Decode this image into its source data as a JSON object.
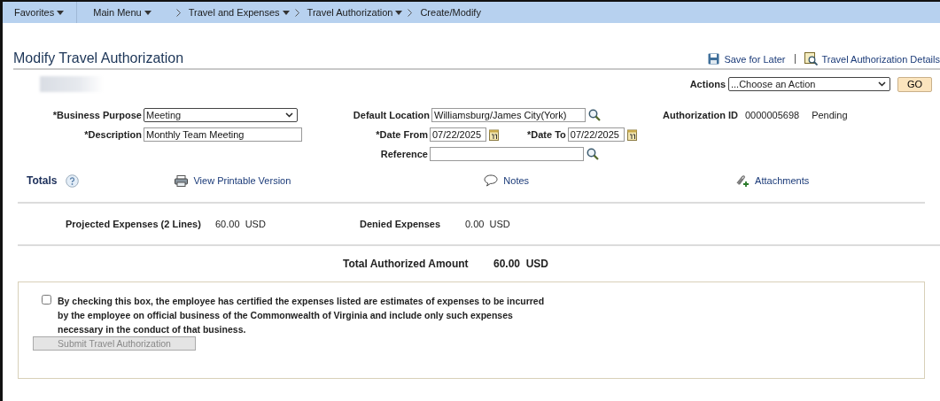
{
  "nav": {
    "favorites": {
      "label": "Favorites",
      "has_menu": true
    },
    "main_menu": {
      "label": "Main Menu",
      "has_menu": true
    },
    "breadcrumbs": [
      {
        "label": "Travel and Expenses",
        "has_menu": true
      },
      {
        "label": "Travel Authorization",
        "has_menu": true
      },
      {
        "label": "Create/Modify",
        "has_menu": false
      }
    ]
  },
  "page_title": "Modify Travel Authorization",
  "header_links": [
    {
      "label": "Save for Later",
      "kind": "save"
    },
    {
      "label": "Travel Authorization Details",
      "kind": "details"
    }
  ],
  "actions": {
    "label": "Actions",
    "value": "...Choose an Action",
    "button": "GO"
  },
  "form": {
    "business_purpose": {
      "label": "*Business Purpose",
      "value": "Meeting"
    },
    "description": {
      "label": "*Description",
      "value": "Monthly Team Meeting"
    },
    "default_location": {
      "label": "Default Location",
      "value": "Williamsburg/James City(York)"
    },
    "date_from": {
      "label": "*Date From",
      "value": "07/22/2025"
    },
    "date_to": {
      "label": "*Date To",
      "value": "07/22/2025"
    },
    "reference": {
      "label": "Reference"
    },
    "authorization_id": {
      "label": "Authorization ID",
      "value": "0000005698",
      "status": "Pending"
    }
  },
  "totals": {
    "title": "Totals",
    "links": [
      {
        "label": "View Printable Version",
        "kind": "print"
      },
      {
        "label": "Notes",
        "kind": "notes"
      },
      {
        "label": "Attachments",
        "kind": "attach"
      }
    ]
  },
  "expenses": {
    "projected": {
      "label": "Projected Expenses (2 Lines)",
      "amount": "60.00",
      "currency": "USD"
    },
    "denied": {
      "label": "Denied Expenses",
      "amount": "0.00",
      "currency": "USD"
    }
  },
  "total_authorized": {
    "label": "Total Authorized Amount",
    "amount": "60.00",
    "currency": "USD"
  },
  "certification": {
    "checked": false,
    "text": "By checking this box, the employee has certified the expenses listed are estimates of expenses to be incurred by the employee on official business of the Commonwealth of Virginia and include only such expenses necessary in the conduct of that business.",
    "button": {
      "label": "Submit Travel Authorization",
      "disabled": true
    }
  }
}
